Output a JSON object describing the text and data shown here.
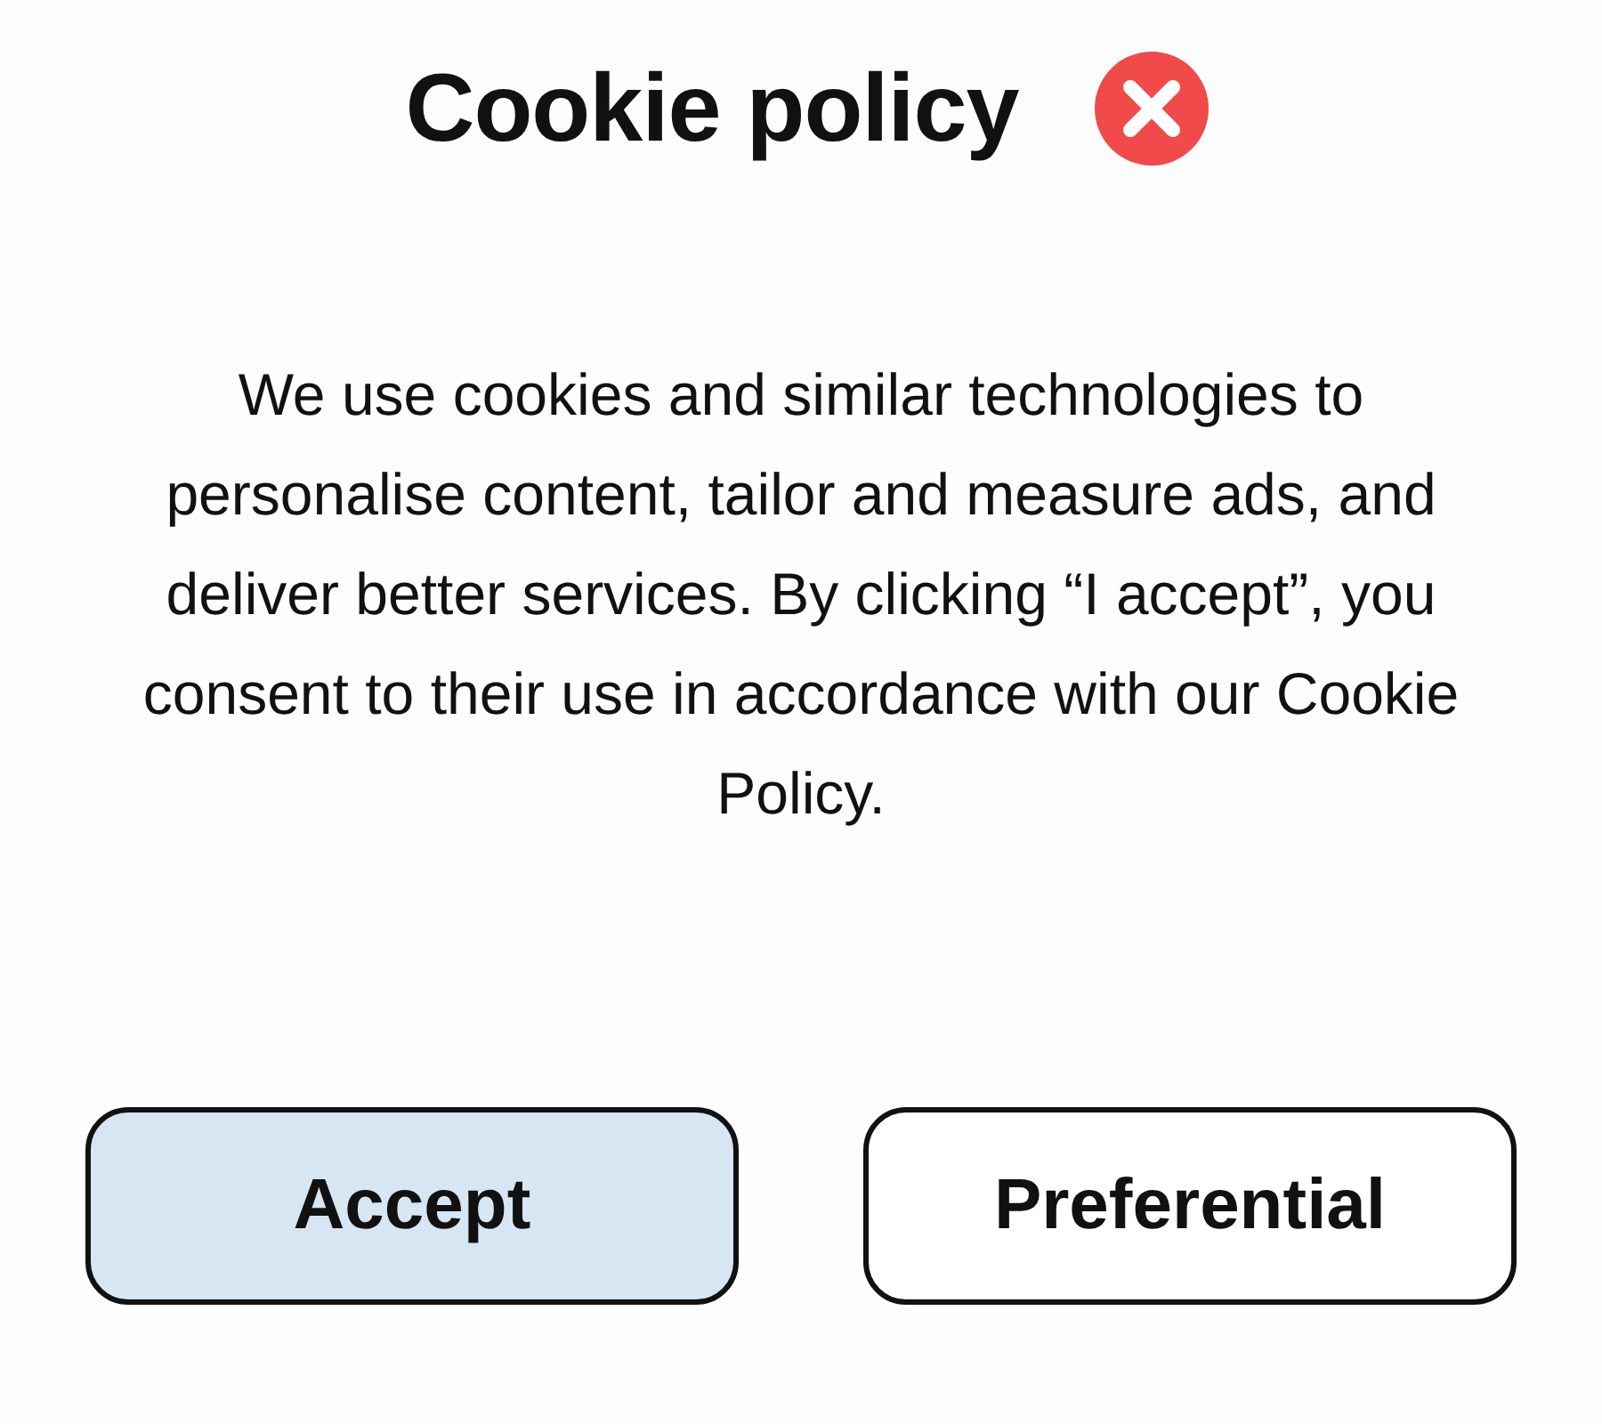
{
  "dialog": {
    "title": "Cookie policy",
    "message": "We use cookies and similar technologies to personalise content, tailor and measure ads, and deliver better services. By clicking “I accept”, you consent to their use in accordance with our Cookie Policy.",
    "buttons": [
      {
        "label": "Accept",
        "kind": "primary"
      },
      {
        "label": "Preferential",
        "kind": "secondary"
      }
    ]
  }
}
